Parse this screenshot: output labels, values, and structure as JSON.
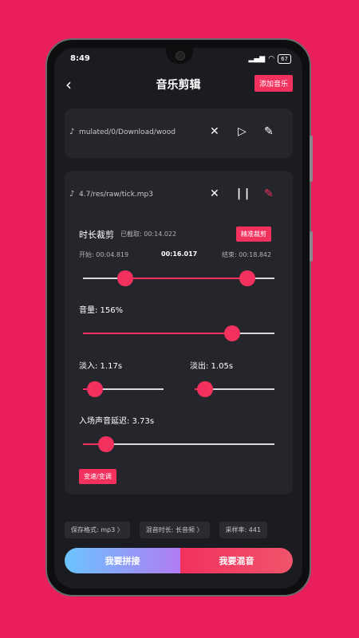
{
  "status": {
    "time": "8:49",
    "battery": "67",
    "signal_icon": "signal-icon",
    "wifi_icon": "wifi-icon"
  },
  "header": {
    "title": "音乐剪辑",
    "add_label": "添加音乐"
  },
  "track1": {
    "path": "mulated/0/Download/wood"
  },
  "track2": {
    "path": "4.7/res/raw/tick.mp3"
  },
  "trim": {
    "title": "时长裁剪",
    "cut_label": "已截取: 00:14.022",
    "precise_label": "精准裁剪",
    "start_label": "开始: 00:04.819",
    "current": "00:16.017",
    "end_label": "结束: 00:18.842",
    "start_fraction": 0.22,
    "end_fraction": 0.86
  },
  "volume": {
    "label": "音量: 156%",
    "fraction": 0.78
  },
  "fade_in": {
    "label": "淡入: 1.17s",
    "fraction": 0.15
  },
  "fade_out": {
    "label": "淡出: 1.05s",
    "fraction": 0.13
  },
  "delay": {
    "label": "入场声音延迟: 3.73s",
    "fraction": 0.12
  },
  "speed_btn": "变速/变调",
  "chips": [
    "保存格式: mp3 〉",
    "混音时长: 长音频 〉",
    "采样率: 441"
  ],
  "buttons": {
    "concat": "我要拼接",
    "mix": "我要混音"
  },
  "colors": {
    "accent": "#f3315e",
    "background": "#e91e5b",
    "concat_gradient": [
      "#6bc4ff",
      "#b07cf2"
    ]
  }
}
